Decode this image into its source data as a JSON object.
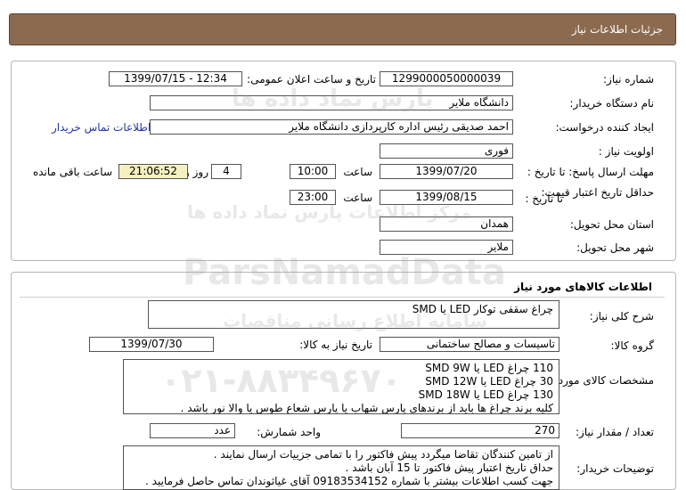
{
  "page": {
    "title": "جزئیات اطلاعات نیاز"
  },
  "need_info": {
    "need_number_label": "شماره نیاز:",
    "need_number": "1299000050000039",
    "announce_datetime_label": "تاریخ و ساعت اعلان عمومی:",
    "announce_datetime": "1399/07/15 - 12:34",
    "buyer_org_label": "نام دستگاه خریدار:",
    "buyer_org": "دانشگاه ملایر",
    "requester_label": "ایجاد کننده درخواست:",
    "requester": "احمد صدیقی رئیس اداره کارپردازی دانشگاه ملایر",
    "contact_link": "اطلاعات تماس خریدار",
    "priority_label": "اولویت نیاز :",
    "priority": "فوری",
    "deadline_label": "مهلت ارسال پاسخ: تا تاریخ :",
    "deadline_date": "1399/07/20",
    "time_label": "ساعت",
    "deadline_time": "10:00",
    "days_value": "4",
    "days_label": "روز و",
    "remaining_time": "21:06:52",
    "remaining_label": "ساعت باقی مانده",
    "price_validity_label": "حداقل تاریخ اعتبار قیمت:",
    "until_date_label": "تا تاریخ :",
    "validity_date": "1399/08/15",
    "validity_time": "23:00",
    "province_label": "استان محل تحویل:",
    "province": "همدان",
    "city_label": "شهر محل تحویل:",
    "city": "ملایر"
  },
  "goods": {
    "section_title": "اطلاعات کالاهای مورد نیاز",
    "description_label": "شرح کلی نیاز:",
    "description": "چراغ سقفی توکار LED  یا SMD",
    "group_label": "گروه کالا:",
    "group": "تاسیسات و مصالح ساختمانی",
    "need_date_label": "تاریخ نیاز به کالا:",
    "need_date": "1399/07/30",
    "specs_label": "مشخصات کالای مورد نیاز:",
    "specs": [
      "110 چراغ  LED یا SMD  9W",
      "30 چراغ  LED یا SMD  12W",
      "130 چراغ LED یا SMD 18W",
      "کلیه برند چراغ ها باید از برندهای پارس شهاب   یا   پارس شعاع طوس   یا   والا نور باشد ."
    ],
    "quantity_label": "تعداد / مقدار نیاز:",
    "quantity": "270",
    "unit_label": "واحد شمارش:",
    "unit": "عدد",
    "buyer_notes_label": "توضیحات خریدار:",
    "buyer_notes": [
      "از تامین کنندگان تقاضا میگردد پیش فاکتور را با تمامی جزییات ارسال نمایند .",
      "حداق تاریخ اعتبار پیش فاکتور تا 15 آبان باشد .",
      "جهت کسب اطلاعات بیشتر با شماره 09183534152 آقای غیاثوندان تماس حاصل فرمایید ."
    ]
  },
  "watermark": {
    "brand_en": "ParsNamadData",
    "brand_fa": "پارس نماد داده ها",
    "tagline_fa": "مرکز اطلاعات پارس نماد داده ها",
    "tagline2_fa": "سامانه اطلاع رسانی مناقصات",
    "phone": "۰۲۱-۸۸۳۴۹۶۷۰"
  }
}
